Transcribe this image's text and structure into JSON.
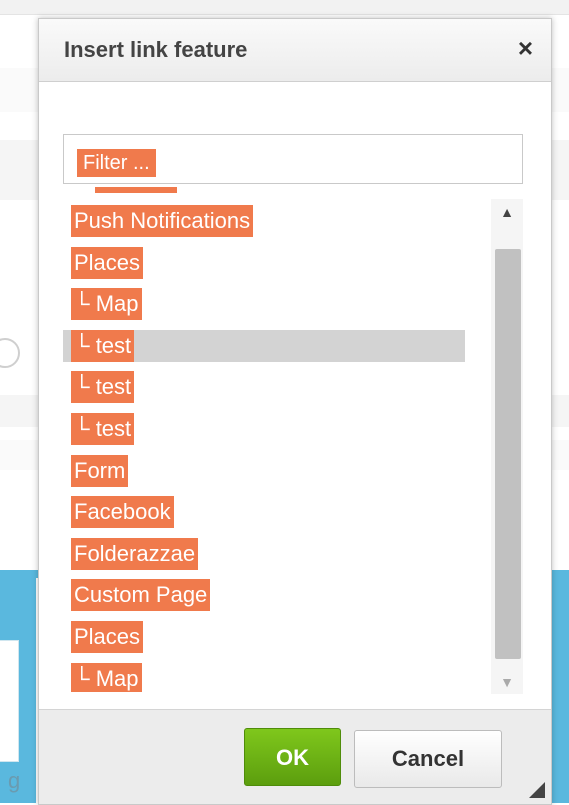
{
  "dialog": {
    "title": "Insert link feature",
    "close_icon": "close-icon",
    "close_label": "×"
  },
  "filter": {
    "placeholder": "Filter ..."
  },
  "list": {
    "items": [
      {
        "label": "Push Notifications",
        "selected": false
      },
      {
        "label": "Places",
        "selected": false
      },
      {
        "label": "└ Map",
        "selected": false
      },
      {
        "label": "└ test",
        "selected": true
      },
      {
        "label": "└ test",
        "selected": false
      },
      {
        "label": "└ test",
        "selected": false
      },
      {
        "label": "Form",
        "selected": false
      },
      {
        "label": "Facebook",
        "selected": false
      },
      {
        "label": "Folderazzae",
        "selected": false
      },
      {
        "label": "Custom Page",
        "selected": false
      },
      {
        "label": "Places",
        "selected": false
      },
      {
        "label": "└ Map",
        "selected": false
      }
    ],
    "scroll_up_label": "▲",
    "scroll_down_label": "▼"
  },
  "footer": {
    "ok_label": "OK",
    "cancel_label": "Cancel"
  },
  "background": {
    "partial_letter": "g"
  },
  "colors": {
    "highlight": "#f07a4c",
    "ok_green": "#6cb415",
    "selected_row": "#d3d3d3",
    "accent_blue": "#5ab8de"
  }
}
